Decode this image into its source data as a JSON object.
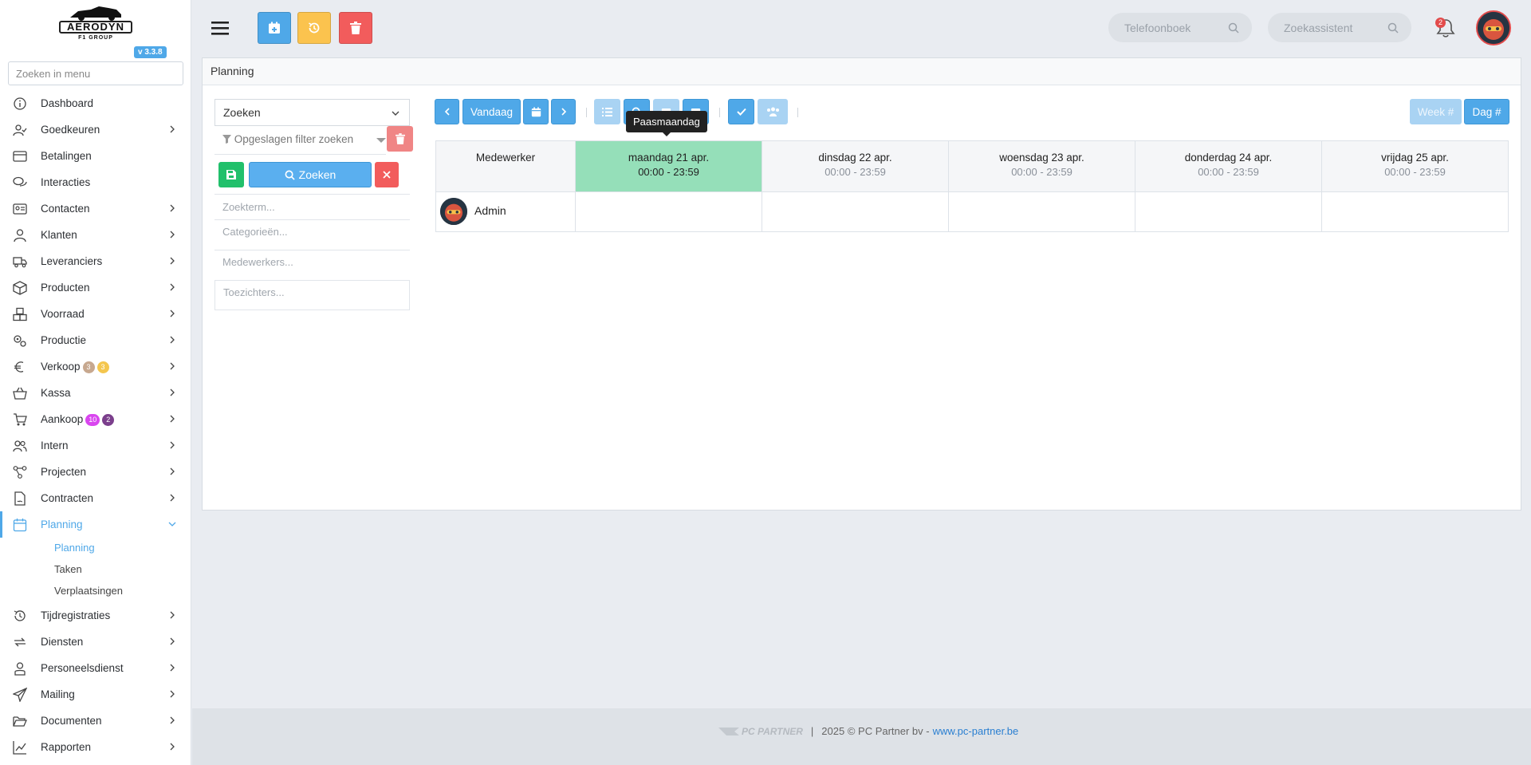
{
  "brand": {
    "logo_title": "AERODYN",
    "logo_sub": "F1 GROUP",
    "version": "v 3.3.8"
  },
  "sidebar": {
    "search_placeholder": "Zoeken in menu",
    "items": [
      {
        "label": "Dashboard"
      },
      {
        "label": "Goedkeuren"
      },
      {
        "label": "Betalingen"
      },
      {
        "label": "Interacties"
      },
      {
        "label": "Contacten"
      },
      {
        "label": "Klanten"
      },
      {
        "label": "Leveranciers"
      },
      {
        "label": "Producten"
      },
      {
        "label": "Voorraad"
      },
      {
        "label": "Productie"
      },
      {
        "label": "Verkoop",
        "badges": [
          "3",
          "3"
        ]
      },
      {
        "label": "Kassa"
      },
      {
        "label": "Aankoop",
        "badges": [
          "10",
          "2"
        ]
      },
      {
        "label": "Intern"
      },
      {
        "label": "Projecten"
      },
      {
        "label": "Contracten"
      },
      {
        "label": "Planning"
      },
      {
        "label": "Tijdregistraties"
      },
      {
        "label": "Diensten"
      },
      {
        "label": "Personeelsdienst"
      },
      {
        "label": "Mailing"
      },
      {
        "label": "Documenten"
      },
      {
        "label": "Rapporten"
      }
    ],
    "planning_sub": [
      "Planning",
      "Taken",
      "Verplaatsingen"
    ]
  },
  "topbar": {
    "phonebook_placeholder": "Telefoonboek",
    "assistant_placeholder": "Zoekassistent",
    "notification_count": "2"
  },
  "panel": {
    "title": "Planning"
  },
  "filter": {
    "select_label": "Zoeken",
    "saved_filter_placeholder": "Opgeslagen filter zoeken",
    "search_button": "Zoeken",
    "fields": [
      "Zoekterm...",
      "Categorieën...",
      "Medewerkers...",
      "Toezichters..."
    ]
  },
  "calendar": {
    "today_button": "Vandaag",
    "week_button": "Week #",
    "day_button": "Dag #",
    "tooltip": "Paasmaandag",
    "employee_header": "Medewerker",
    "days": [
      {
        "label": "maandag 21 apr.",
        "time": "00:00 - 23:59"
      },
      {
        "label": "dinsdag 22 apr.",
        "time": "00:00 - 23:59"
      },
      {
        "label": "woensdag 23 apr.",
        "time": "00:00 - 23:59"
      },
      {
        "label": "donderdag 24 apr.",
        "time": "00:00 - 23:59"
      },
      {
        "label": "vrijdag 25 apr.",
        "time": "00:00 - 23:59"
      }
    ],
    "employees": [
      {
        "name": "Admin"
      }
    ]
  },
  "footer": {
    "brand": "PC PARTNER",
    "text": "2025 © PC Partner bv - ",
    "link": "www.pc-partner.be"
  },
  "colors": {
    "accent": "#4fa8e8",
    "today": "#95dfb9",
    "danger": "#f25c5c",
    "warning": "#fbc34e",
    "success": "#21c06b"
  }
}
